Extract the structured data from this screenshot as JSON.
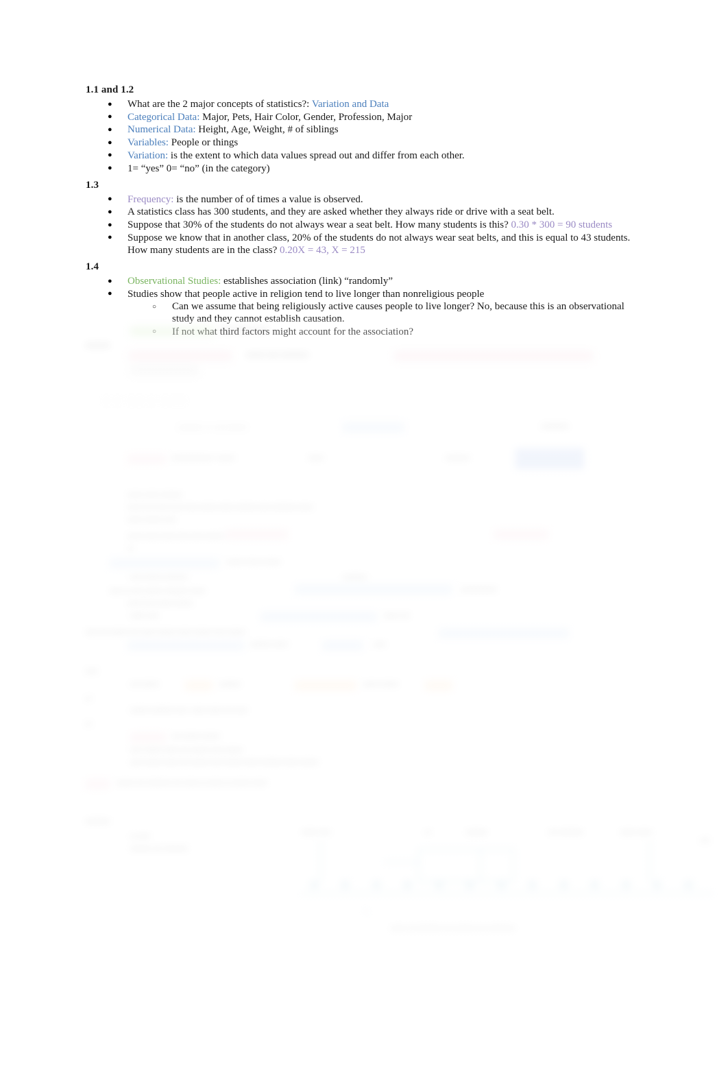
{
  "document": {
    "type": "study-notes",
    "subject": "Statistics",
    "font_style": "serif",
    "page_background": "#ffffff"
  },
  "colors": {
    "key_blue": "#4a7ebb",
    "key_purple": "#9a8ac4",
    "key_green": "#79b45f",
    "body_text": "#1a1a1a",
    "highlight_blue_box": "#9fb8ec",
    "diagram_teal": "#8fc0d4"
  },
  "sections": [
    {
      "id": "sec-1-1-1-2",
      "heading": "1.1 and 1.2",
      "items": [
        {
          "term": "",
          "term_color": "",
          "text_before": "What are the 2 major concepts of statistics?: ",
          "text": "",
          "answer": "Variation and Data",
          "answer_color": "key_blue"
        },
        {
          "term": "Categorical Data:",
          "term_color": "key_blue",
          "text": " Major, Pets, Hair Color, Gender, Profession, Major"
        },
        {
          "term": "Numerical Data:",
          "term_color": "key_blue",
          "text": " Height, Age, Weight, # of siblings"
        },
        {
          "term": "Variables:",
          "term_color": "key_blue",
          "text": " People or things"
        },
        {
          "term": "Variation:",
          "term_color": "key_blue",
          "text": " is the extent to which data values spread out and differ from each other."
        },
        {
          "term": "",
          "term_color": "",
          "text": "1= “yes” 0= “no” (in the category)"
        }
      ]
    },
    {
      "id": "sec-1-3",
      "heading": "1.3",
      "items": [
        {
          "term": "Frequency:",
          "term_color": "key_purple",
          "text": " is the number of  of times a value is observed."
        },
        {
          "term": "",
          "term_color": "",
          "text": "A statistics class has 300 students, and they are asked whether they always ride or drive with a seat belt."
        },
        {
          "term": "",
          "term_color": "",
          "text": "Suppose that 30% of the students do not always wear a seat belt. How many students is this? ",
          "answer": "0.30 * 300 = 90 students",
          "answer_color": "key_purple"
        },
        {
          "term": "",
          "term_color": "",
          "text": "Suppose we know that in another class, 20% of the students do not always wear seat belts, and this is equal to 43 students. How many students are in the class? ",
          "answer": "0.20X = 43, X = 215",
          "answer_color": "key_purple"
        }
      ]
    },
    {
      "id": "sec-1-4",
      "heading": "1.4",
      "items": [
        {
          "term": "Observational Studies:",
          "term_color": "key_green",
          "text": " establishes association (link) “randomly”"
        },
        {
          "term": "",
          "term_color": "",
          "text": "Studies show that people active in religion tend to live longer than nonreligious people",
          "subitems": [
            "Can we assume that being religiously active causes people to live longer? No, because this is an observational study and they cannot establish causation.",
            " If not what third factors might account for the association?"
          ]
        }
      ]
    }
  ],
  "faded_region": {
    "note": "Remainder of page is blurred and illegible",
    "visible_traits": [
      "pink highlighted phrases",
      "blue highlighted phrases",
      "orange highlighted phrases",
      "green highlighted phrase",
      "solid blue highlighted block",
      "teal dotplot / number-line diagram near bottom"
    ]
  }
}
